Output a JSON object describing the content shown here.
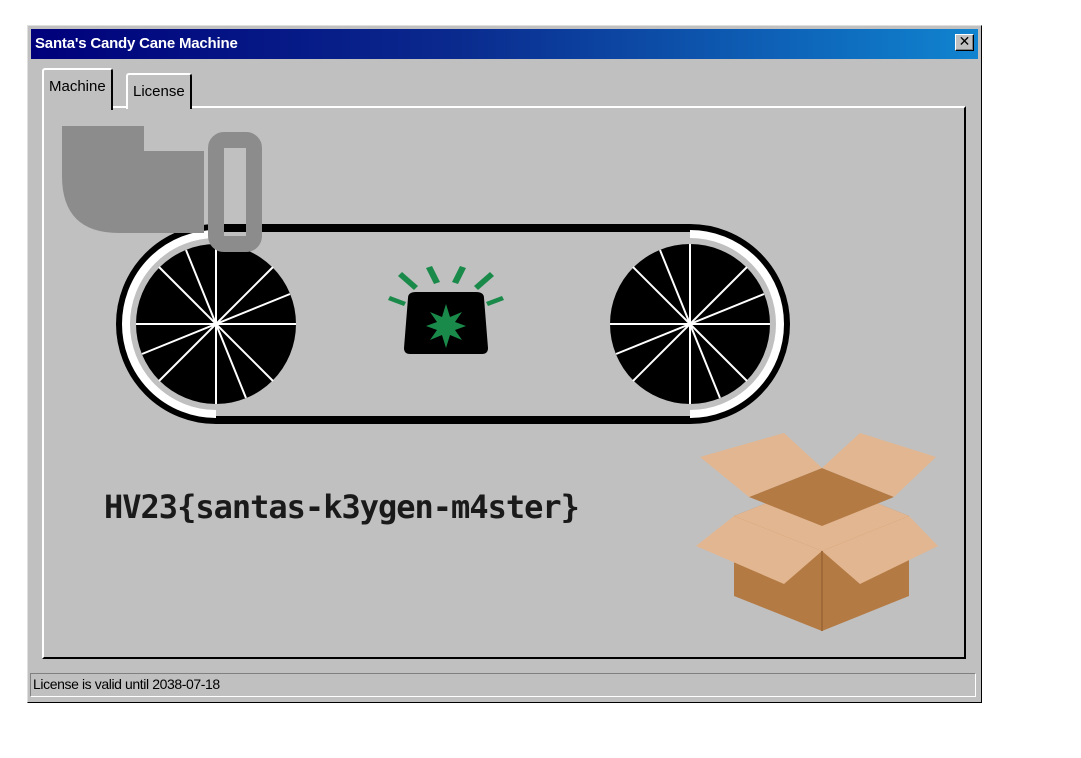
{
  "window": {
    "title": "Santa's Candy Cane Machine",
    "close_label": "✕"
  },
  "tabs": [
    {
      "label": "Machine",
      "selected": true
    },
    {
      "label": "License",
      "selected": false
    }
  ],
  "machine": {
    "flag_text": "HV23{santas-k3ygen-m4ster}",
    "indicator_light": "green",
    "colors": {
      "light_green": "#1a8a4a",
      "box_light": "#e2b690",
      "box_dark": "#b47a44",
      "hopper": "#8c8c8c"
    }
  },
  "status": {
    "text": "License is valid until 2038-07-18"
  }
}
